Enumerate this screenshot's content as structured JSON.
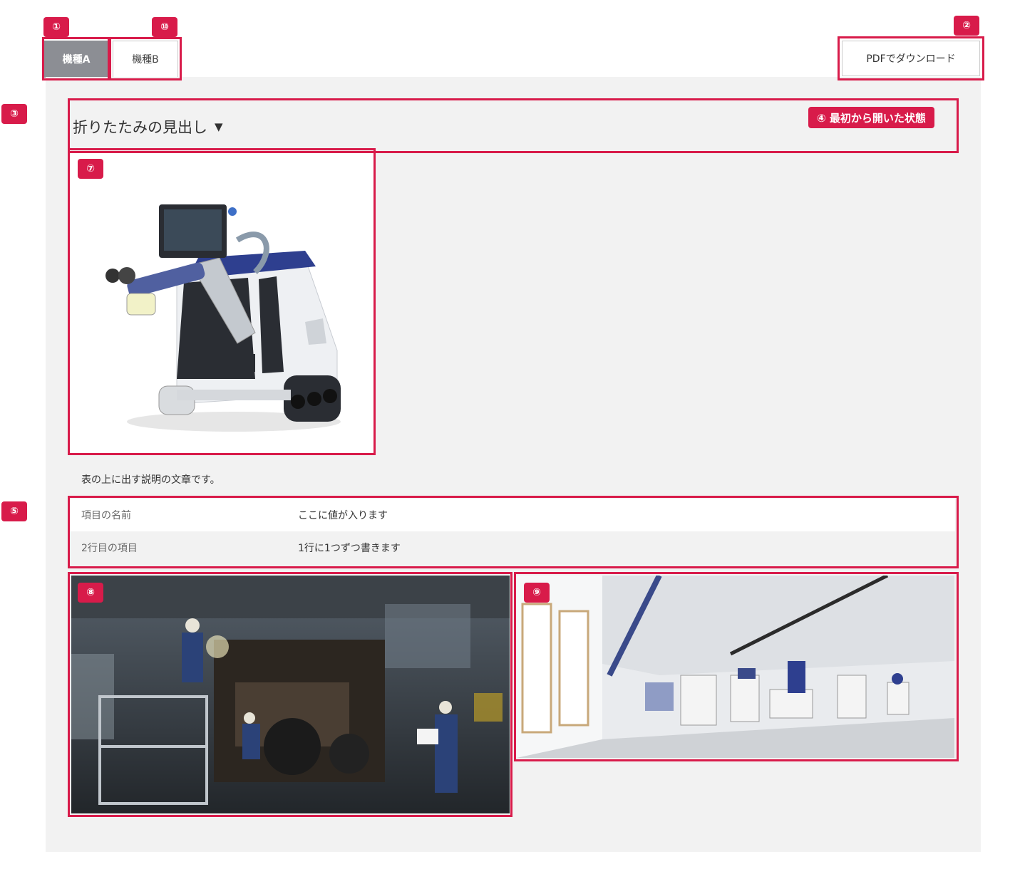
{
  "tabs": [
    {
      "label": "機種A",
      "active": true
    },
    {
      "label": "機種B",
      "active": false
    }
  ],
  "download_button": {
    "label": "PDFでダウンロード"
  },
  "accordion": {
    "title": "折りたたみの見出し",
    "caret": "▼",
    "open_state_note": "④ 最初から開いた状態"
  },
  "description": "表の上に出す説明の文章です。",
  "table": {
    "rows": [
      {
        "key": "項目の名前",
        "value": "ここに値が入ります"
      },
      {
        "key": "2行目の項目",
        "value": "1行に1つずつ書きます"
      }
    ]
  },
  "annotations": {
    "n1": "①",
    "n2": "②",
    "n3": "③",
    "n5": "⑤",
    "n7": "⑦",
    "n8": "⑧",
    "n9": "⑨",
    "n10": "⑩"
  },
  "colors": {
    "accent": "#d81b4a",
    "panel_bg": "#f2f2f2",
    "active_tab": "#8c8e94"
  }
}
